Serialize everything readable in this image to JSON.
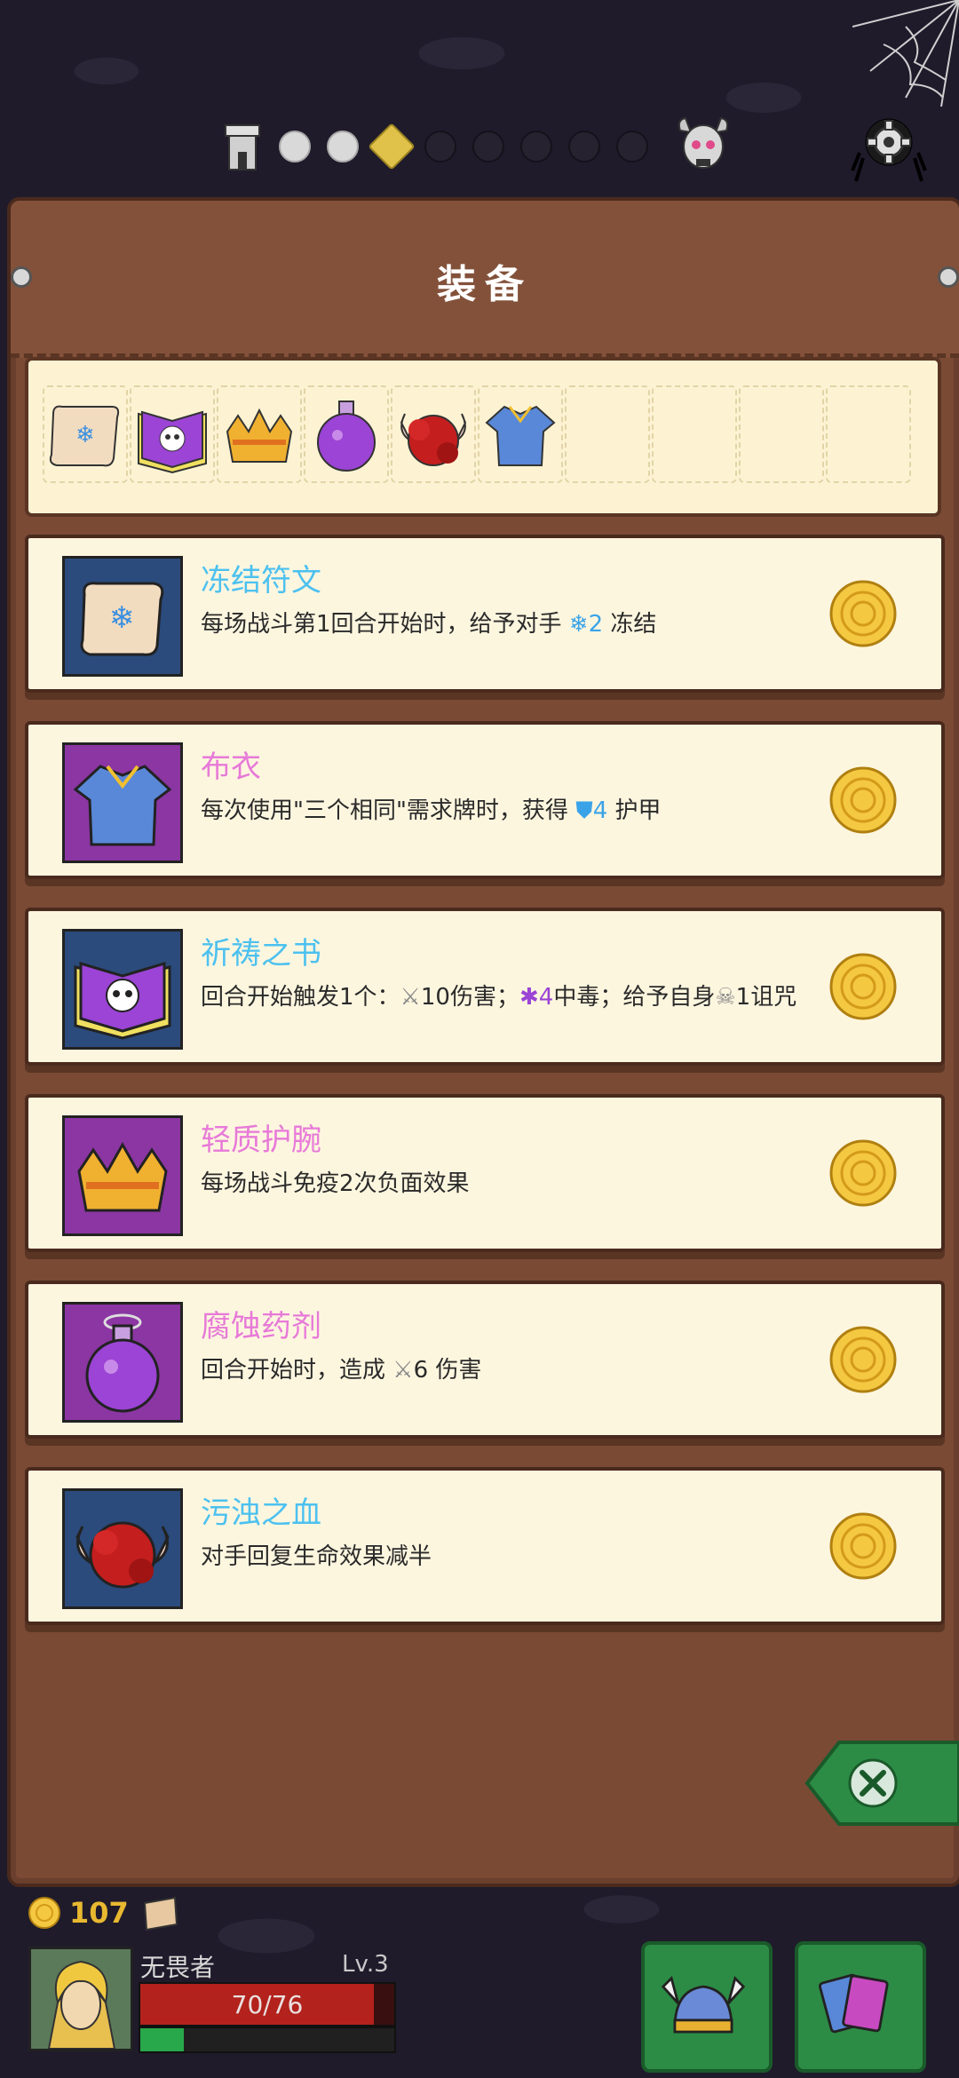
{
  "panel": {
    "title": "装备"
  },
  "strip": {
    "icons": [
      "scroll-rune-icon",
      "prayer-book-icon",
      "crown-bracer-icon",
      "potion-icon",
      "blood-icon",
      "cloth-shirt-icon"
    ]
  },
  "cards": [
    {
      "name": "冻结符文",
      "desc_before": "每场战斗第1回合开始时，给予对手 ",
      "value": "2",
      "desc_after": " 冻结",
      "icon": "scroll-rune-icon"
    },
    {
      "name": "布衣",
      "desc_before": "每次使用\"三个相同\"需求牌时，获得 ",
      "value": "4",
      "desc_after": " 护甲",
      "icon": "cloth-shirt-icon"
    },
    {
      "name": "祈祷之书",
      "desc_a": "回合开始触发1个：",
      "dmg": "10",
      "desc_b": "伤害；",
      "poison": "4",
      "desc_c": "中毒；给予自身",
      "curse": "1",
      "desc_d": "诅咒",
      "icon": "prayer-book-icon"
    },
    {
      "name": "轻质护腕",
      "desc": "每场战斗免疫2次负面效果",
      "icon": "crown-bracer-icon"
    },
    {
      "name": "腐蚀药剂",
      "desc_before": "回合开始时，造成 ",
      "value": "6",
      "desc_after": " 伤害",
      "icon": "potion-icon"
    },
    {
      "name": "污浊之血",
      "desc": "对手回复生命效果减半",
      "icon": "blood-icon"
    }
  ],
  "player": {
    "gold": "107",
    "name": "无畏者",
    "level": "Lv.3",
    "hp_text": "70/76",
    "hp_fraction": 0.92,
    "xp_fraction": 0.17
  },
  "progress": {
    "done": 2,
    "current": 1,
    "remaining": 5
  }
}
